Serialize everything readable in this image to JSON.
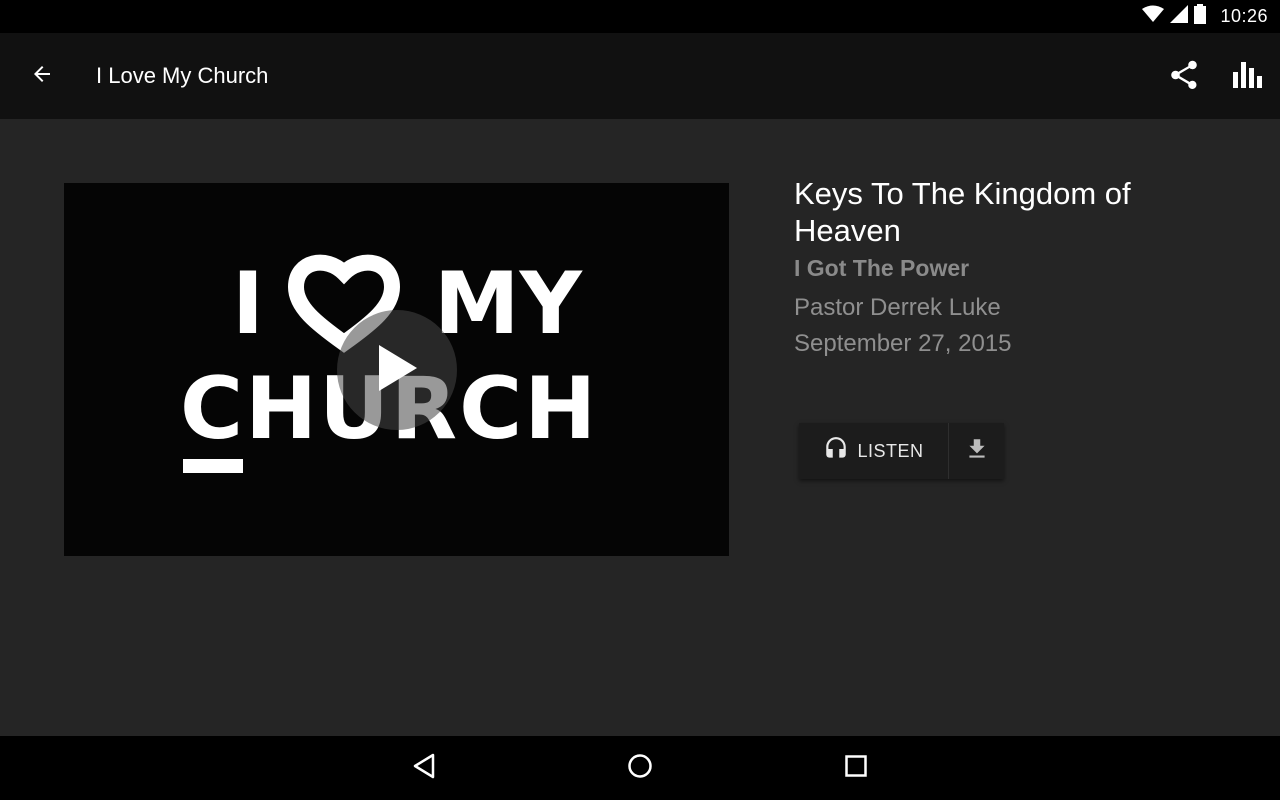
{
  "status_bar": {
    "time": "10:26",
    "icons": [
      "wifi-icon",
      "cell-signal-icon",
      "battery-icon"
    ]
  },
  "app_bar": {
    "title": "I Love My Church",
    "back_icon": "arrow-back-icon",
    "actions": [
      "share-icon",
      "bar-chart-icon"
    ]
  },
  "media": {
    "artwork_text": [
      "I",
      "MY",
      "CHURCH"
    ],
    "play_icon": "play-icon"
  },
  "sermon": {
    "title": "Keys To The Kingdom of Heaven",
    "series": "I Got The Power",
    "speaker": "Pastor Derrek Luke",
    "date": "September 27, 2015"
  },
  "actions": {
    "listen_label": "LISTEN",
    "listen_icon": "headphones-icon",
    "download_icon": "download-icon"
  },
  "nav_bar": {
    "buttons": [
      "nav-back-icon",
      "nav-home-icon",
      "nav-recents-icon"
    ]
  },
  "colors": {
    "app_bar_bg": "#111111",
    "content_bg": "#252525",
    "secondary_text": "#8f8f8f"
  }
}
